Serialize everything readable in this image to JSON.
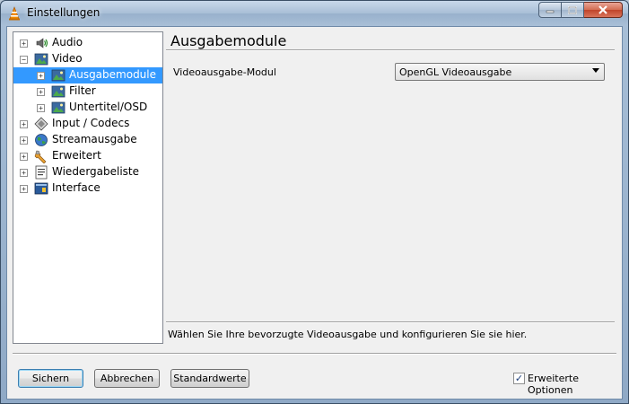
{
  "window": {
    "title": "Einstellungen"
  },
  "tree": {
    "items": [
      {
        "label": "Audio",
        "expander": "+",
        "icon": "speaker-icon"
      },
      {
        "label": "Video",
        "expander": "−",
        "icon": "video-icon"
      },
      {
        "label": "Ausgabemodule",
        "expander": "+",
        "icon": "video-icon"
      },
      {
        "label": "Filter",
        "expander": "+",
        "icon": "video-icon"
      },
      {
        "label": "Untertitel/OSD",
        "expander": "+",
        "icon": "video-icon"
      },
      {
        "label": "Input / Codecs",
        "expander": "+",
        "icon": "codec-icon"
      },
      {
        "label": "Streamausgabe",
        "expander": "+",
        "icon": "globe-icon"
      },
      {
        "label": "Erweitert",
        "expander": "+",
        "icon": "wrench-icon"
      },
      {
        "label": "Wiedergabeliste",
        "expander": "+",
        "icon": "playlist-icon"
      },
      {
        "label": "Interface",
        "expander": "+",
        "icon": "interface-icon"
      }
    ]
  },
  "panel": {
    "title": "Ausgabemodule",
    "field_label": "Videoausgabe-Modul",
    "select_value": "OpenGL Videoausgabe",
    "description": "Wählen Sie Ihre bevorzugte Videoausgabe und konfigurieren Sie sie hier."
  },
  "buttons": {
    "save": "Sichern",
    "cancel": "Abbrechen",
    "defaults": "Standardwerte"
  },
  "advanced": {
    "label": "Erweiterte Optionen",
    "check": "✓"
  },
  "colors": {
    "selection": "#3399ff",
    "accent_close": "#c0442a"
  }
}
